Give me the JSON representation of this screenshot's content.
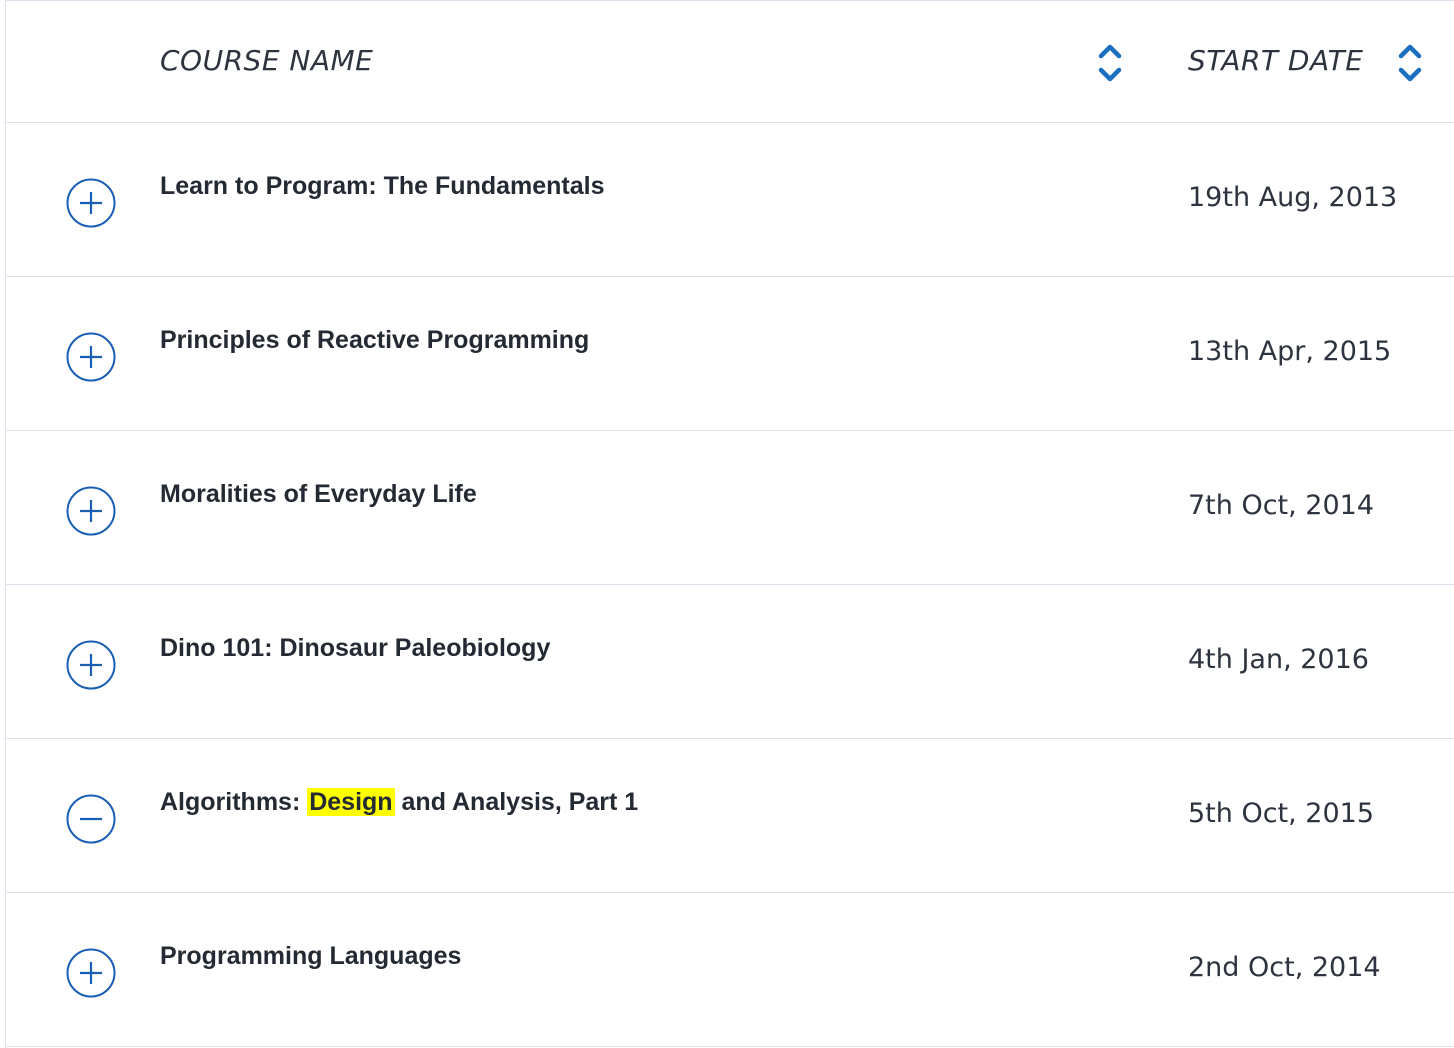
{
  "header": {
    "course_name_label": "COURSE NAME",
    "start_date_label": "START DATE"
  },
  "colors": {
    "accent": "#1a5fb4",
    "sort_icon": "#1a6fc0",
    "highlight": "#ffff00",
    "divider": "#dbe3ef"
  },
  "icons": {
    "expand": "plus-circle-icon",
    "collapse": "minus-circle-icon",
    "sort": "sort-arrows-icon"
  },
  "rows": [
    {
      "name_before": "Learn to Program: The Fundamentals",
      "name_highlight": "",
      "name_after": "",
      "start_date": "19th Aug, 2013",
      "expanded": false
    },
    {
      "name_before": "Principles of Reactive Programming",
      "name_highlight": "",
      "name_after": "",
      "start_date": "13th Apr, 2015",
      "expanded": false
    },
    {
      "name_before": "Moralities of Everyday Life",
      "name_highlight": "",
      "name_after": "",
      "start_date": "7th Oct, 2014",
      "expanded": false
    },
    {
      "name_before": "Dino 101: Dinosaur Paleobiology",
      "name_highlight": "",
      "name_after": "",
      "start_date": "4th Jan, 2016",
      "expanded": false
    },
    {
      "name_before": "Algorithms: ",
      "name_highlight": "Design",
      "name_after": " and Analysis, Part 1",
      "start_date": "5th Oct, 2015",
      "expanded": true
    },
    {
      "name_before": "Programming Languages",
      "name_highlight": "",
      "name_after": "",
      "start_date": "2nd Oct, 2014",
      "expanded": false
    }
  ]
}
